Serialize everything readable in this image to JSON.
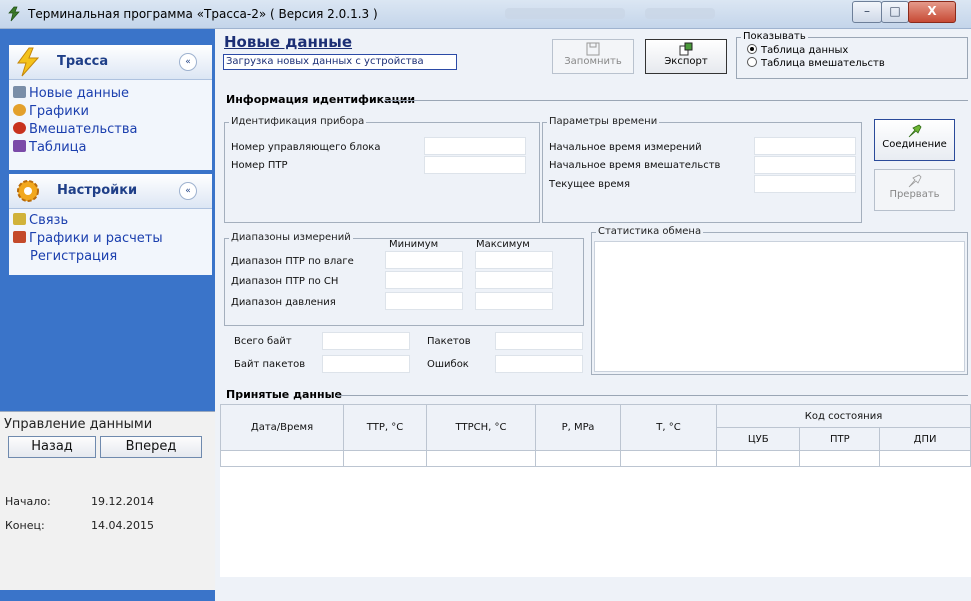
{
  "window": {
    "title": "Терминальная программа «Трасса-2» ( Версия 2.0.1.3 )",
    "controls": {
      "minimize": "–",
      "maximize": "□",
      "close": "X"
    }
  },
  "sidebar": {
    "section1": {
      "title": "Трасса",
      "collapse": "«",
      "items": [
        {
          "label": "Новые данные",
          "icon": "data-icon"
        },
        {
          "label": "Графики",
          "icon": "chart-icon"
        },
        {
          "label": "Вмешательства",
          "icon": "question-icon"
        },
        {
          "label": "Таблица",
          "icon": "table-icon"
        }
      ]
    },
    "section2": {
      "title": "Настройки",
      "collapse": "«",
      "items": [
        {
          "label": "Связь",
          "icon": "link-icon"
        },
        {
          "label": "Графики и расчеты",
          "icon": "calc-icon"
        },
        {
          "label": "Регистрация",
          "icon": ""
        }
      ]
    },
    "data_control": {
      "label": "Управление данными",
      "back": "Назад",
      "forward": "Вперед",
      "start_label": "Начало:",
      "start_value": "19.12.2014",
      "end_label": "Конец:",
      "end_value": "14.04.2015"
    }
  },
  "header": {
    "title": "Новые данные",
    "subtitle": "Загрузка новых данных с устройства",
    "save": "Запомнить",
    "export": "Экспорт",
    "show": {
      "label": "Показывать",
      "option1": "Таблица данных",
      "option2": "Таблица вмешательств",
      "selected": "Таблица данных"
    }
  },
  "identification": {
    "title": "Информация идентификации",
    "device": {
      "legend": "Идентификация прибора",
      "control_unit": "Номер управляющего блока",
      "ptr": "Номер ПТР"
    },
    "time": {
      "legend": "Параметры времени",
      "meas_start": "Начальное время измерений",
      "interv_start": "Начальное время вмешательств",
      "current": "Текущее время"
    },
    "connect": "Соединение",
    "abort": "Прервать",
    "ranges": {
      "legend": "Диапазоны измерений",
      "min": "Минимум",
      "max": "Максимум",
      "ptr_moisture": "Диапазон ПТР по влаге",
      "ptr_ch": "Диапазон ПТР по СН",
      "pressure": "Диапазон давления"
    },
    "exchange": {
      "legend": "Статистика обмена",
      "total_bytes": "Всего байт",
      "packets": "Пакетов",
      "packet_bytes": "Байт пакетов",
      "errors": "Ошибок"
    }
  },
  "received": {
    "title": "Принятые данные",
    "columns": [
      "Дата/Время",
      "TTP, °C",
      "TTPCH, °C",
      "P, MPa",
      "T, °C"
    ],
    "state_group": "Код состояния",
    "state_columns": [
      "ЦУБ",
      "ПТР",
      "ДПИ"
    ]
  },
  "colors": {
    "sidebar_bg": "#3a74c9",
    "link_text": "#1b3fae",
    "title_text": "#1c2f75"
  }
}
